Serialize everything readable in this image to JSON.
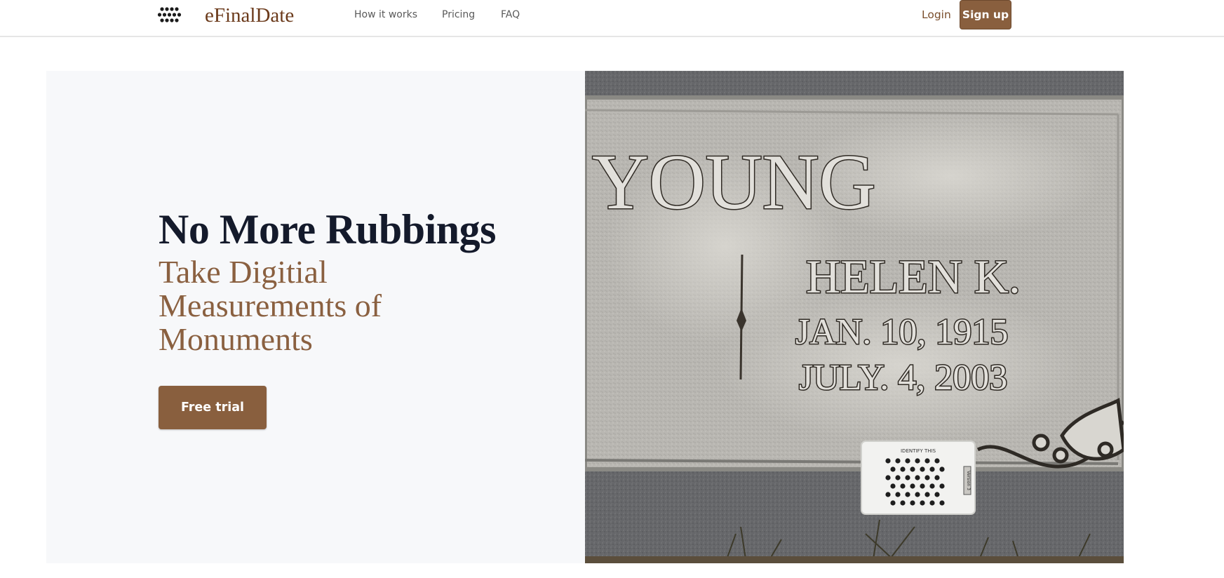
{
  "brand": {
    "name": "eFinalDate",
    "logo_icon": "dot-grid-logo-icon"
  },
  "nav": {
    "links": [
      {
        "label": "How it works"
      },
      {
        "label": "Pricing"
      },
      {
        "label": "FAQ"
      }
    ],
    "login_label": "Login",
    "signup_label": "Sign up"
  },
  "hero": {
    "title": "No More Rubbings",
    "subtitle": "Take Digitial Measurements of Monuments",
    "cta_label": "Free trial"
  },
  "photo": {
    "surname": "YOUNG",
    "first_name": "HELEN K.",
    "birth_date": "JAN. 10, 1915",
    "death_date": "JULY. 4, 2003",
    "card_heading": "IDENTIFY THIS",
    "card_version": "Version 3"
  },
  "colors": {
    "accent": "#895f3e",
    "brand_text": "#6b3a1b",
    "heading": "#141a2b",
    "subheading": "#8a6040",
    "hero_bg": "#f7f8fa"
  }
}
